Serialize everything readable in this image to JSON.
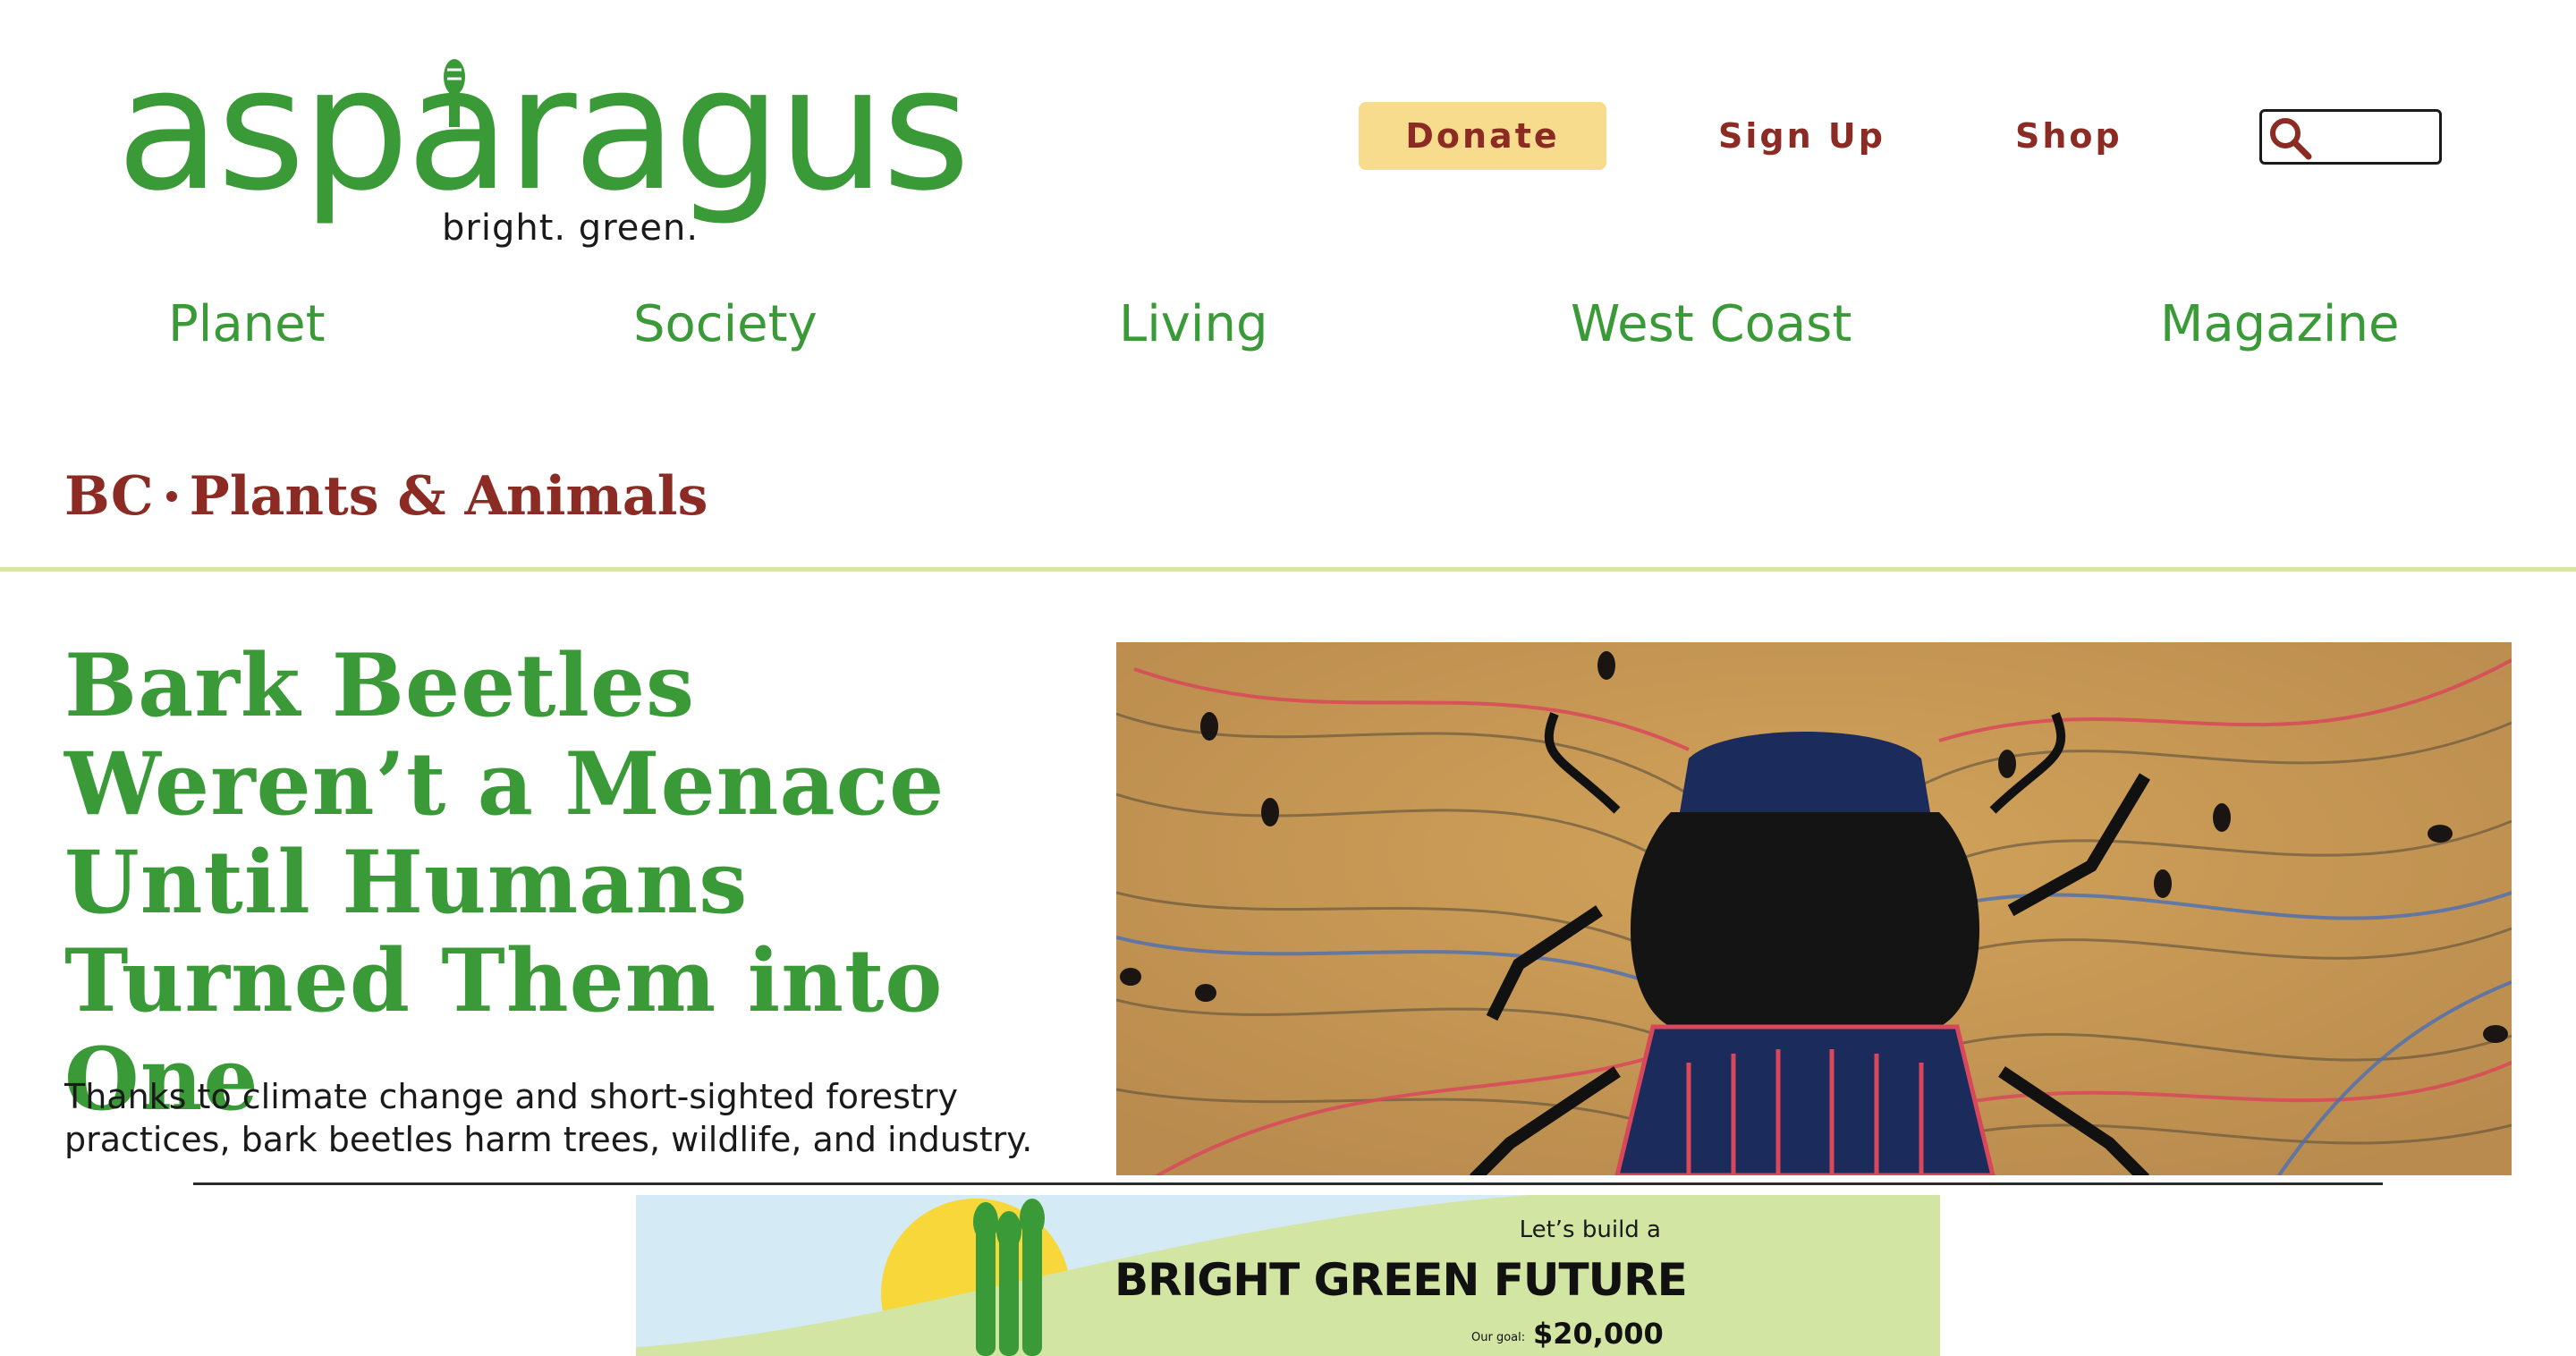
{
  "brand": {
    "name": "asparagus",
    "tagline": "bright. green."
  },
  "header": {
    "donate_label": "Donate",
    "signup_label": "Sign Up",
    "shop_label": "Shop",
    "search_placeholder": ""
  },
  "nav": {
    "items": [
      {
        "label": "Planet"
      },
      {
        "label": "Society"
      },
      {
        "label": "Living"
      },
      {
        "label": "West Coast"
      },
      {
        "label": "Magazine"
      }
    ]
  },
  "section": {
    "region": "BC",
    "category": "Plants & Animals"
  },
  "article": {
    "headline": "Bark Beetles Weren’t a Menace Until Humans Turned Them into One",
    "dek": "Thanks to climate change and short-sighted forestry practices, bark beetles harm trees, wildlife, and industry.",
    "hero_icon": "beetle-illustration"
  },
  "banner": {
    "lead": "Let’s build a",
    "title": "BRIGHT GREEN FUTURE",
    "goal_label": "Our goal:",
    "goal_value": "$20,000"
  },
  "colors": {
    "brand_green": "#3a9a37",
    "accent_red": "#8c2b24",
    "donate_bg": "#f7dc8d",
    "divider_green": "#d8e4a8"
  }
}
